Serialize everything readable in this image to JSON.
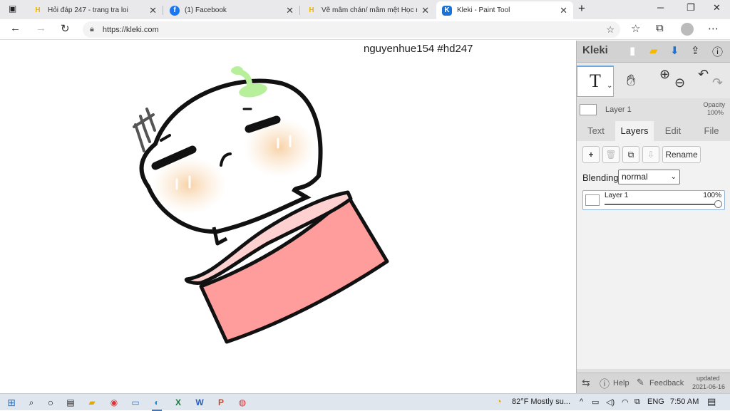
{
  "browser": {
    "tabs": [
      {
        "title": "Hỏi đáp 247 - trang tra loi",
        "favicon": "hoidap-icon",
        "active": false
      },
      {
        "title": "(1) Facebook",
        "favicon": "facebook-icon",
        "active": false
      },
      {
        "title": "Vẽ mâm chán/ mâm mệt Học nh",
        "favicon": "hoidap-icon",
        "active": false
      },
      {
        "title": "Kleki - Paint Tool",
        "favicon": "kleki-icon",
        "active": true
      }
    ],
    "new_tab": "+",
    "url": "https://kleki.com"
  },
  "canvas": {
    "caption": "nguyenhue154 #hd247"
  },
  "kleki": {
    "logo": "Kleki",
    "tool_label": "T",
    "current_layer": "Layer 1",
    "opacity_label": "Opacity",
    "opacity_value": "100%",
    "tabs": [
      "Text",
      "Layers",
      "Edit",
      "File"
    ],
    "active_tab": "Layers",
    "buttons": {
      "add": "+",
      "delete": "🗑",
      "duplicate": "⧉",
      "merge": "⇩",
      "rename": "Rename"
    },
    "blending_label": "Blending",
    "blending_value": "normal",
    "layers": [
      {
        "name": "Layer 1",
        "opacity": "100%",
        "opacity_fraction": 1.0
      }
    ],
    "footer": {
      "help": "Help",
      "feedback": "Feedback",
      "updated_label": "updated",
      "updated_date": "2021-06-16"
    },
    "accent_color": "#1a73d9"
  },
  "taskbar": {
    "weather": "82°F  Mostly su...",
    "language": "ENG",
    "time": "7:50 AM"
  }
}
